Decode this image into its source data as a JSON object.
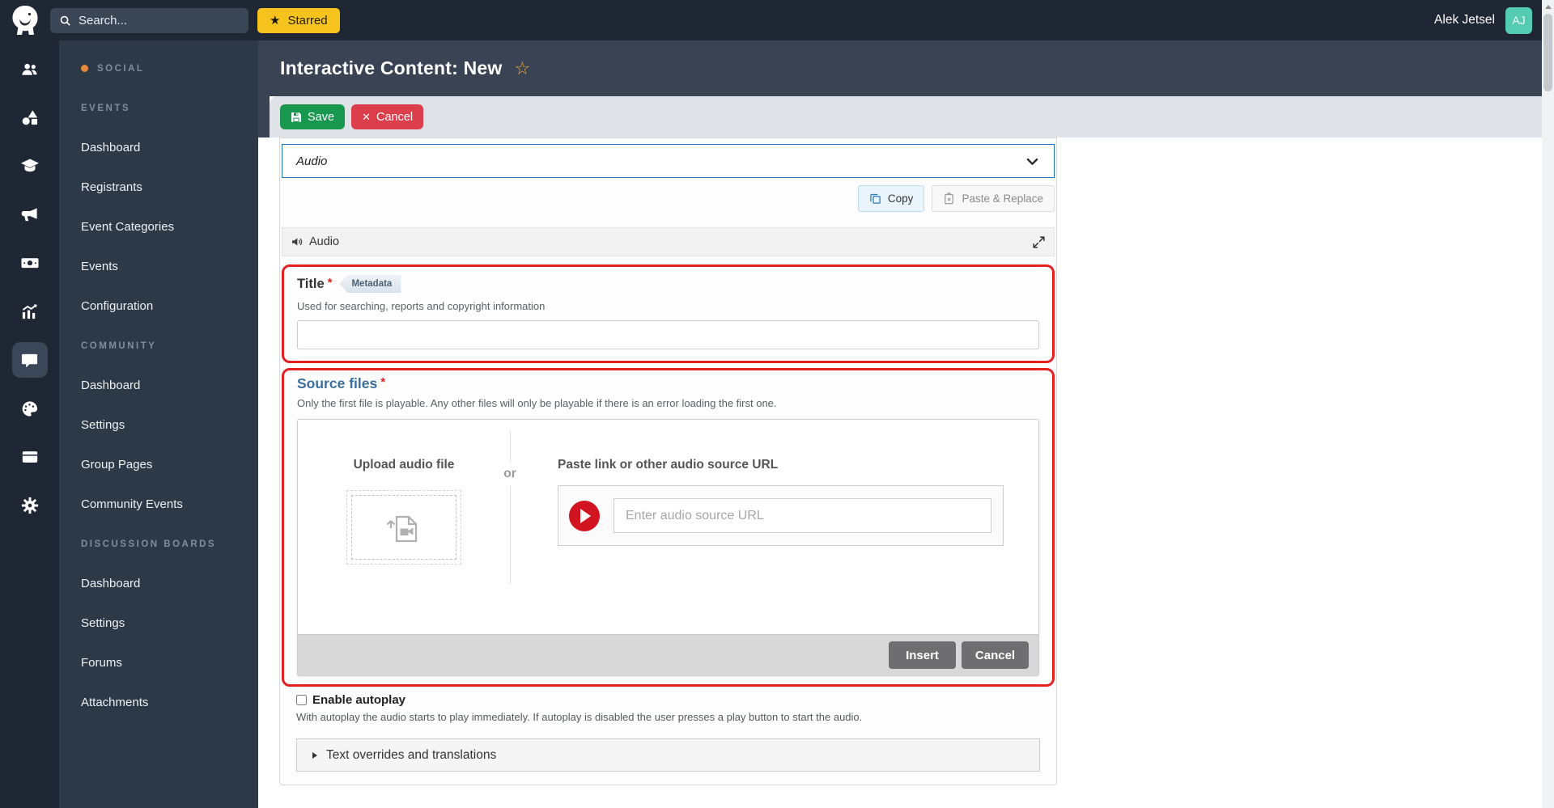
{
  "topbar": {
    "search_placeholder": "Search...",
    "starred_label": "Starred",
    "user_name": "Alek Jetsel",
    "user_initials": "AJ"
  },
  "rail_icons": [
    "users",
    "shapes",
    "graduation-cap",
    "megaphone",
    "banknote",
    "analytics",
    "chat",
    "palette",
    "wallet",
    "settings-gear"
  ],
  "rail_active_icon": "chat",
  "sidebar": {
    "sections": [
      {
        "header": "SOCIAL",
        "items": []
      },
      {
        "header": "EVENTS",
        "items": [
          "Dashboard",
          "Registrants",
          "Event Categories",
          "Events",
          "Configuration"
        ]
      },
      {
        "header": "COMMUNITY",
        "items": [
          "Dashboard",
          "Settings",
          "Group Pages",
          "Community Events"
        ]
      },
      {
        "header": "DISCUSSION BOARDS",
        "items": [
          "Dashboard",
          "Settings",
          "Forums",
          "Attachments"
        ]
      }
    ]
  },
  "page": {
    "title": "Interactive Content: New"
  },
  "toolbar": {
    "save_label": "Save",
    "cancel_label": "Cancel"
  },
  "content_picker": {
    "selected_type": "Audio",
    "copy_label": "Copy",
    "paste_replace_label": "Paste & Replace"
  },
  "audio_widget": {
    "header": "Audio",
    "title_field": {
      "label": "Title",
      "badge": "Metadata",
      "help": "Used for searching, reports and copyright information",
      "value": ""
    },
    "source_files": {
      "label": "Source files",
      "help": "Only the first file is playable. Any other files will only be playable if there is an error loading the first one.",
      "upload_heading": "Upload audio file",
      "or_label": "or",
      "paste_heading": "Paste link or other audio source URL",
      "url_placeholder": "Enter audio source URL",
      "url_value": "",
      "insert_label": "Insert",
      "cancel_label": "Cancel"
    },
    "autoplay": {
      "label": "Enable autoplay",
      "checked": false,
      "help": "With autoplay the audio starts to play immediately. If autoplay is disabled the user presses a play button to start the audio."
    },
    "text_overrides_label": "Text overrides and translations"
  },
  "colors": {
    "topbar_bg": "#1f2734",
    "sidebar_bg": "#2e3947",
    "page_header_bg": "#3a4354",
    "toolbar_bg": "#dfe2e7",
    "save_green": "#18984f",
    "cancel_red": "#dd3e4c",
    "starred_yellow": "#f6c21d",
    "avatar_teal": "#54ccb2",
    "section_dot_orange": "#e8883b",
    "required_red": "#e5201e",
    "selector_border_blue": "#1b74bc",
    "source_files_blue": "#3a6e9c",
    "play_button_red": "#d21420",
    "fav_star_yellow": "#f0ab3e"
  }
}
